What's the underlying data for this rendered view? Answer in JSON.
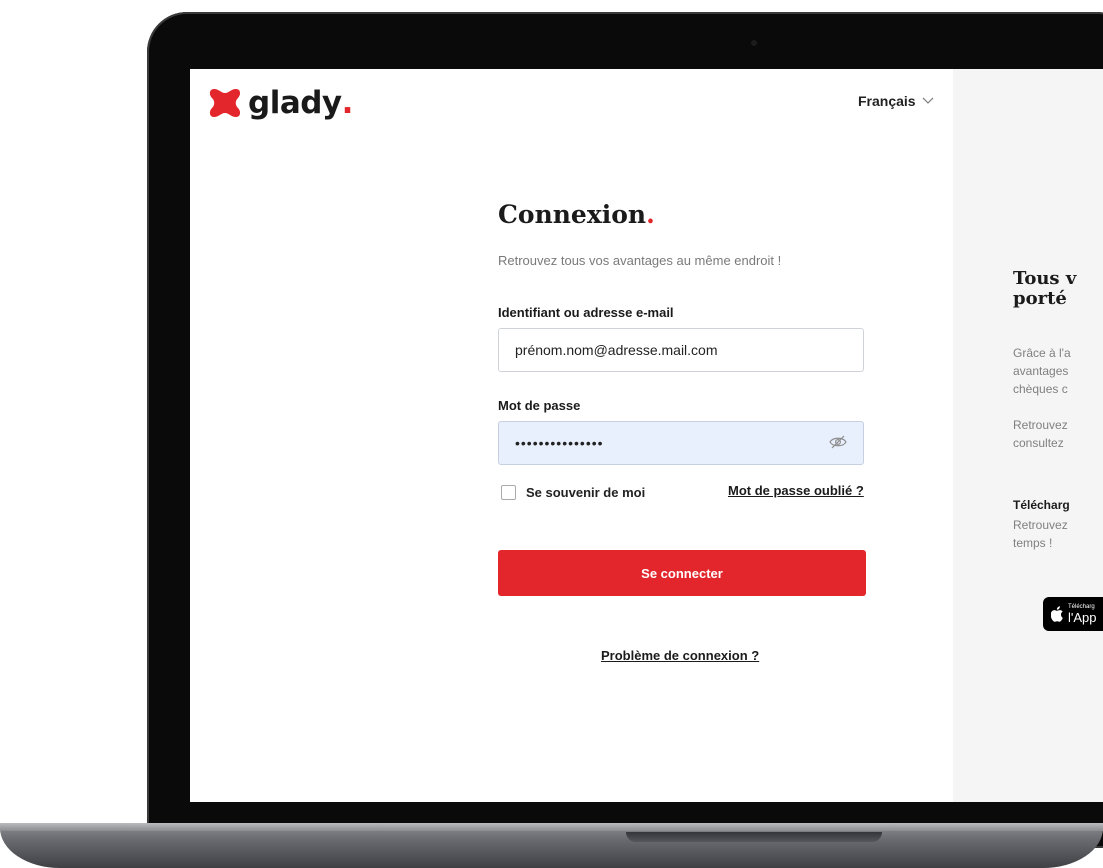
{
  "brand": {
    "name": "glady",
    "dot": ".",
    "accent": "#e3262b"
  },
  "header": {
    "language": "Français",
    "language_icon": "chevron-down-icon"
  },
  "login": {
    "title": "Connexion",
    "title_dot": ".",
    "subtitle": "Retrouvez tous vos avantages au même endroit !",
    "identifier_label": "Identifiant ou adresse e-mail",
    "identifier_value": "prénom.nom@adresse.mail.com",
    "password_label": "Mot de passe",
    "password_value": "•••••••••••••••",
    "password_icon": "eye-slash-icon",
    "remember_label": "Se souvenir de moi",
    "forgot_link": "Mot de passe oublié ?",
    "submit_label": "Se connecter",
    "problem_link": "Problème de connexion ?"
  },
  "promo": {
    "title": "Tous v\nporté",
    "paragraph1": "Grâce à l'a\navantages\nchèques c",
    "paragraph2": "Retrouvez\nconsultez",
    "download_heading": "Télécharg",
    "download_text": "Retrouvez\ntemps !",
    "appstore_small": "Télécharg",
    "appstore_big": "l'App"
  }
}
